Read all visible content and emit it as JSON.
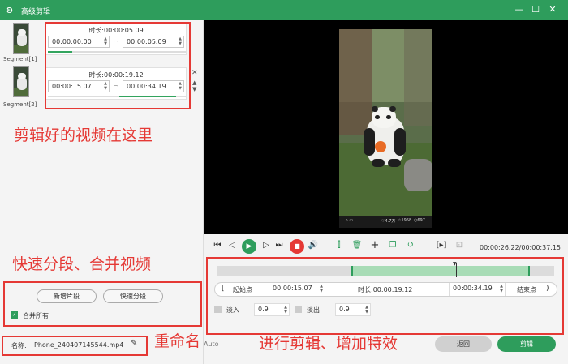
{
  "app": {
    "title": "高级剪辑",
    "logo_icon": "bunny-logo-icon"
  },
  "segments": [
    {
      "label": "Segment[1]",
      "duration_label": "时长:",
      "duration": "00:00:05.09",
      "start": "00:00:00.00",
      "end": "00:00:05.09"
    },
    {
      "label": "Segment[2]",
      "duration_label": "时长:",
      "duration": "00:00:19.12",
      "start": "00:00:15.07",
      "end": "00:00:34.19"
    }
  ],
  "annotations": {
    "clips": "剪辑好的视频在这里",
    "split_merge": "快速分段、合并视频",
    "rename": "重命名",
    "edit": "进行剪辑、增加特效"
  },
  "left_actions": {
    "new_segment": "新增片段",
    "quick_split": "快速分段",
    "merge_all": "合并所有",
    "merge_checked": true
  },
  "filename": {
    "label": "名称:",
    "value": "Phone_240407145544.mp4"
  },
  "video_overlay": {
    "counts": [
      "4.7万",
      "1958",
      "697"
    ]
  },
  "player": {
    "time": "00:00:26.22/00:00:37.15"
  },
  "edit": {
    "start_label": "起始点",
    "start_value": "00:00:15.07",
    "duration_label": "时长:",
    "duration_value": "00:00:19.12",
    "end_value": "00:00:34.19",
    "end_label": "结束点",
    "fade_in_label": "淡入",
    "fade_in_value": "0.9",
    "fade_out_label": "淡出",
    "fade_out_value": "0.9",
    "format_partial": "Auto",
    "back_button": "返回",
    "cut_button": "剪辑"
  },
  "colors": {
    "brand": "#2e9d5c",
    "annotation": "#e53935",
    "timeline_selection": "#a8dcb6"
  }
}
